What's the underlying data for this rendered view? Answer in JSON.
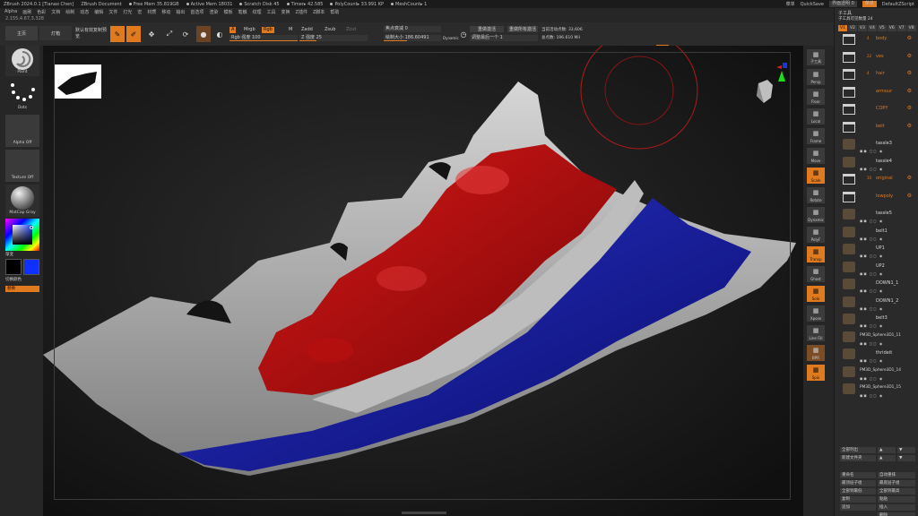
{
  "titlebar": {
    "app": "ZBrush 2024.0.1 [Tianao Chen]",
    "doc": "ZBrush Document",
    "free_mem": "Free Mem 35.819GB",
    "active_mem": "Active Mem 18031",
    "scratch": "Scratch Disk 45",
    "timer": "Timer▸ 42.585",
    "polycount": "PolyCount▸ 33.991 KP",
    "meshcount": "MeshCount▸ 1",
    "menus_label": "菜单",
    "quicksave": "QuickSave",
    "transparency": "界面透明 0",
    "menu_btn": "菜单",
    "script": "DefaultZScript"
  },
  "menubar": [
    "Alpha",
    "画刷",
    "色彩",
    "文档",
    "绘制",
    "动态",
    "编辑",
    "文件",
    "灯光",
    "宏",
    "材质",
    "移动",
    "输出",
    "首选项",
    "渲染",
    "模板",
    "笔触",
    "纹理",
    "工具",
    "变换",
    "Z插件",
    "Z脚本",
    "帮助"
  ],
  "coords": "2.155,4.67,3.328",
  "toolbar": {
    "lightbox": "主页",
    "light": "灯箱",
    "spotlight": "默认有效复制预览",
    "edit": "Edit",
    "draw": "Draw",
    "move": "Move",
    "scale": "Scale",
    "rotate": "Rotate",
    "a_chip": "A",
    "mrgb": "Mrgb",
    "rgb": "Rgb",
    "m": "M",
    "zadd": "Zadd",
    "zsub": "Zsub",
    "zcut": "Zcut",
    "rgb_intensity": "Rgb 强度 100",
    "z_intensity": "Z 强度 25",
    "focal_shift": "焦点衰减 0",
    "draw_size": "绘制大小 186.60491",
    "dynamic": "Dynamic",
    "redo_active": "重做激活",
    "redo_all": "重做所有激活",
    "adjust_last": "调整最后一个 1",
    "active_points": "当前活动点数: 33,606",
    "total_points": "总点数: 196.610 Mil"
  },
  "leftshelf": {
    "brush": "Paint",
    "stroke": "Dots",
    "alpha": "Alpha Off",
    "texture": "Texture Off",
    "material": "MatCap Gray",
    "gradient": "渐变",
    "switch_color": "切换颜色",
    "alternate": "替换"
  },
  "rightshelf": [
    "子工具",
    "Persp",
    "Floor",
    "Local",
    "Frame",
    "Move",
    "Scale",
    "Rotate",
    "Dynamic",
    "PolyF",
    "Transp",
    "Ghost",
    "Solo",
    "Xpose",
    "Line Fill",
    "BPR",
    "Spix"
  ],
  "panel": {
    "header": "子工具",
    "subtitle": "子工具可见数量 24",
    "tabs": [
      "V1",
      "V2",
      "V3",
      "V4",
      "V5",
      "V6",
      "V7",
      "V8"
    ],
    "items": [
      {
        "name": "body",
        "num": "4",
        "kind": "folder"
      },
      {
        "name": "ves",
        "num": "22",
        "kind": "folder"
      },
      {
        "name": "hair",
        "num": "4",
        "kind": "folder"
      },
      {
        "name": "armour",
        "num": "",
        "kind": "folder"
      },
      {
        "name": "COPY",
        "num": "",
        "kind": "folder"
      },
      {
        "name": "belt",
        "num": "",
        "kind": "folder"
      },
      {
        "name": "tassle3",
        "num": "",
        "kind": "mesh"
      },
      {
        "name": "tassle4",
        "num": "",
        "kind": "mesh"
      },
      {
        "name": "original",
        "num": "10",
        "kind": "folder"
      },
      {
        "name": "lowpoly",
        "num": "",
        "kind": "folder"
      },
      {
        "name": "tassle5",
        "num": "",
        "kind": "mesh"
      },
      {
        "name": "belt1",
        "num": "",
        "kind": "mesh"
      },
      {
        "name": "UP1",
        "num": "",
        "kind": "mesh"
      },
      {
        "name": "UP2",
        "num": "",
        "kind": "mesh"
      },
      {
        "name": "DOWN1_1",
        "num": "",
        "kind": "mesh"
      },
      {
        "name": "DOWN1_2",
        "num": "",
        "kind": "mesh"
      },
      {
        "name": "belt3",
        "num": "",
        "kind": "mesh"
      },
      {
        "name": "PM3D_Sphere3D1_11",
        "num": "",
        "kind": "mesh"
      },
      {
        "name": "thrideit",
        "num": "",
        "kind": "mesh"
      },
      {
        "name": "PM3D_Sphere3D1_14",
        "num": "",
        "kind": "mesh"
      },
      {
        "name": "PM3D_Sphere3D1_15",
        "num": "",
        "kind": "mesh"
      }
    ],
    "buttons": {
      "list_all": "全部列出",
      "new_folder": "新建文件夹",
      "rename": "重命名",
      "auto_reorder": "自动重排",
      "up": "最顶层子组",
      "down": "最底层子组",
      "all_low": "全部到最低",
      "all_high": "全部到最高",
      "copy": "复制",
      "paste": "粘贴",
      "append": "追加",
      "insert": "插入",
      "delete": "删除"
    }
  }
}
